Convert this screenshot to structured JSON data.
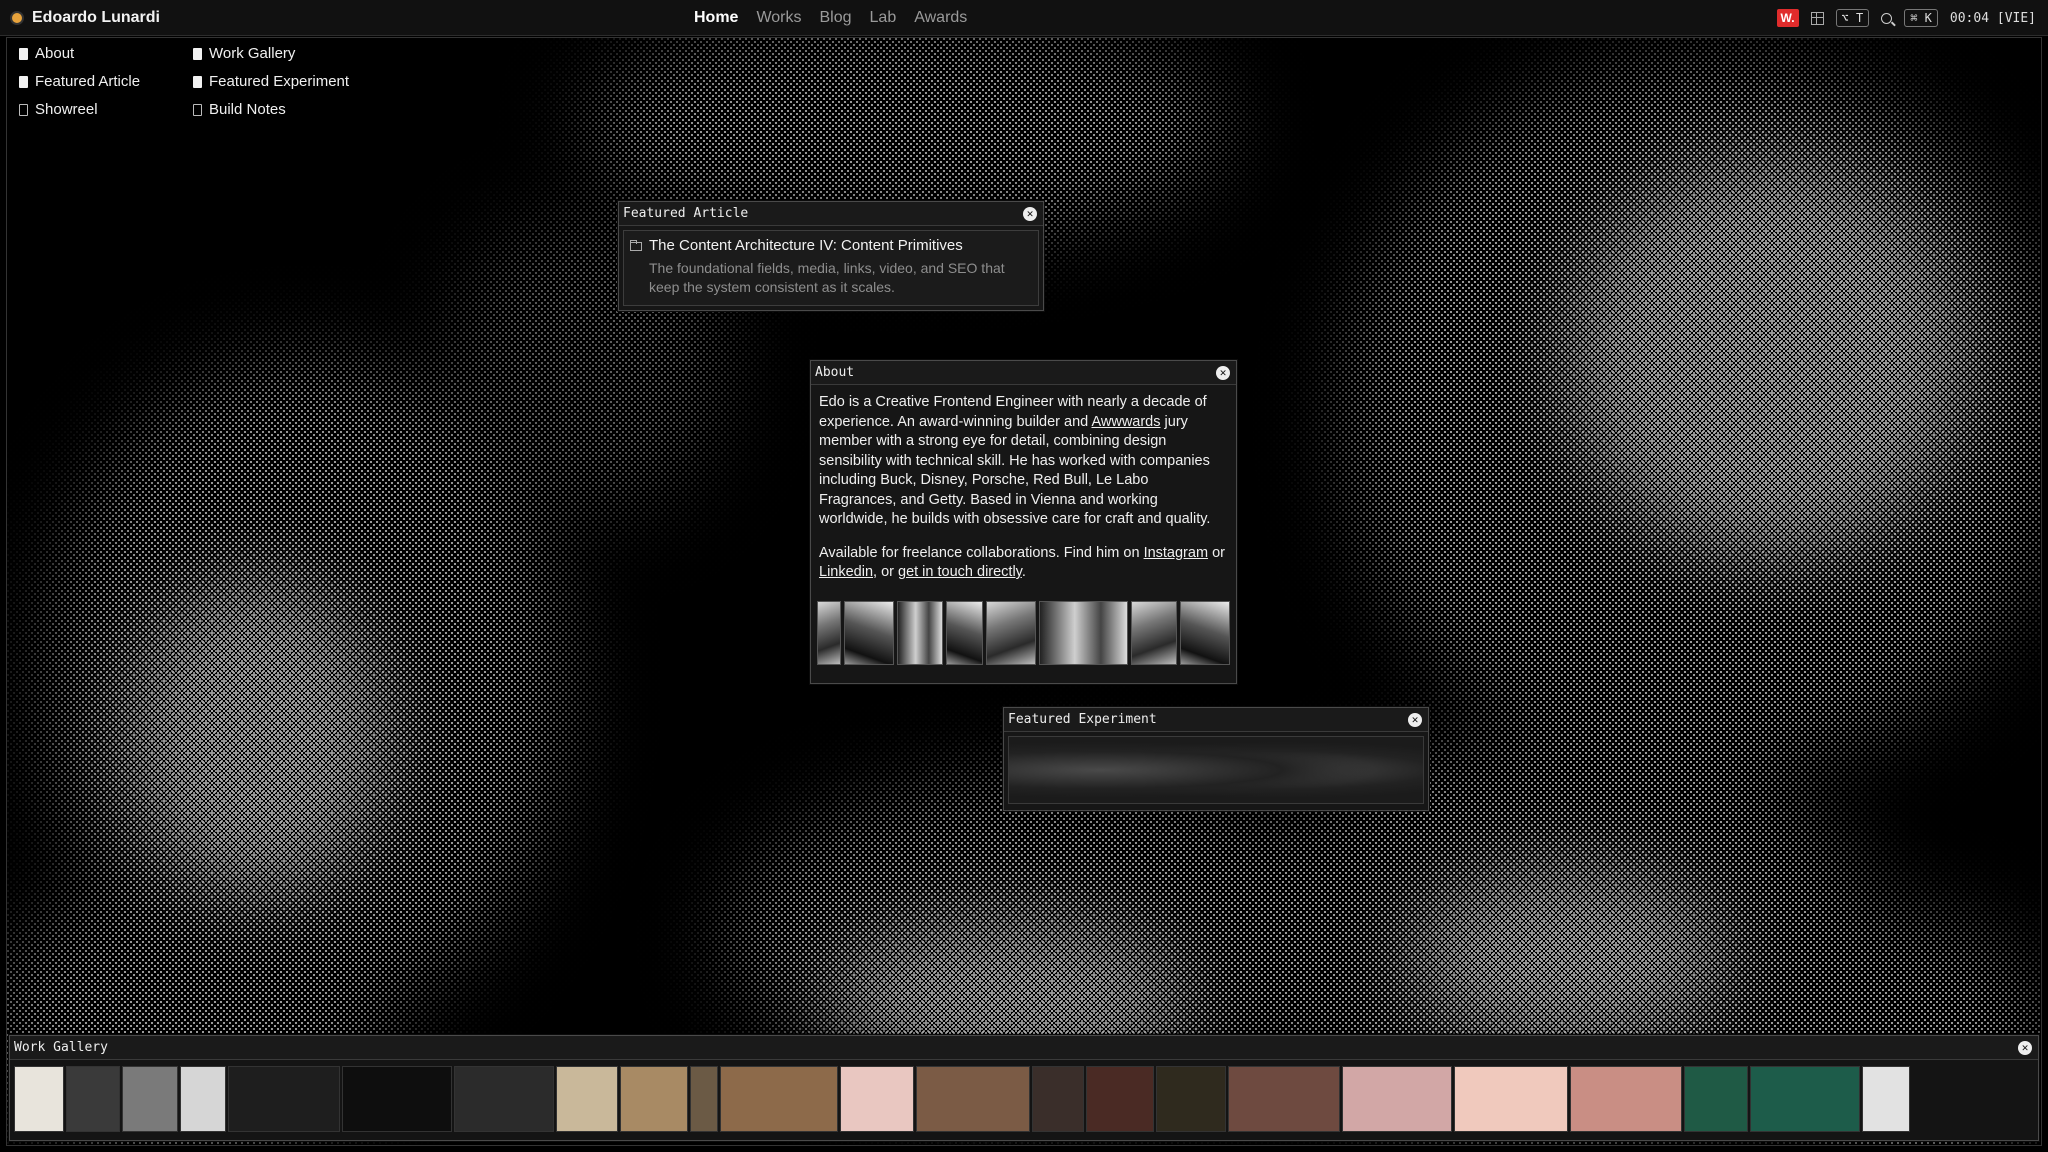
{
  "topbar": {
    "brand": "Edoardo Lunardi",
    "nav": [
      "Home",
      "Works",
      "Blog",
      "Lab",
      "Awards"
    ],
    "nav_active": "Home",
    "w_badge": "W.",
    "shortcut_theme": "⌥ T",
    "shortcut_search": "⌘ K",
    "clock": "00:04 [VIE]"
  },
  "desktop_icons": {
    "about": "About",
    "featured_article": "Featured Article",
    "showreel": "Showreel",
    "work_gallery": "Work Gallery",
    "featured_experiment": "Featured Experiment",
    "build_notes": "Build Notes"
  },
  "article_window": {
    "title": "Featured Article",
    "item_title": "The Content Architecture IV: Content Primitives",
    "item_desc": "The foundational fields, media, links, video, and SEO that keep the system consistent as it scales."
  },
  "about_window": {
    "title": "About",
    "p1_a": "Edo is a Creative Frontend Engineer with nearly a decade of experience. An award-winning builder and ",
    "p1_link": "Awwwards",
    "p1_b": " jury member with a strong eye for detail, combining design sensibility with technical skill. He has worked with companies including Buck, Disney, Porsche, Red Bull, Le Labo Fragrances, and Getty. Based in Vienna and working worldwide, he builds with obsessive care for craft and quality.",
    "p2_a": "Available for freelance collaborations. Find him on ",
    "p2_link1": "Instagram",
    "p2_b": " or ",
    "p2_link2": "Linkedin",
    "p2_c": ", or ",
    "p2_link3": "get in touch directly",
    "p2_d": "."
  },
  "experiment_window": {
    "title": "Featured Experiment"
  },
  "gallery_window": {
    "title": "Work Gallery",
    "thumb_colors": [
      "#e8e4dc",
      "#3a3a3a",
      "#7a7a7a",
      "#d6d6d6",
      "#1e1e1e",
      "#0e0e0e",
      "#2b2b2b",
      "#c9b89a",
      "#a88a64",
      "#6b5a45",
      "#8d6a4a",
      "#e9c7c1",
      "#7b5b45",
      "#3a2e2a",
      "#4a2a24",
      "#2f2a1e",
      "#6e4a40",
      "#d2a7a6",
      "#f0c9bd",
      "#c98e84",
      "#1f5a45",
      "#1d5c4a",
      "#e2e2e2"
    ],
    "thumb_widths": [
      50,
      54,
      56,
      46,
      112,
      110,
      100,
      62,
      68,
      28,
      118,
      74,
      114,
      52,
      68,
      70,
      112,
      110,
      114,
      112,
      64,
      110,
      48
    ]
  },
  "colors": {
    "accent_red": "#e02c2c",
    "background": "#000000",
    "pattern": "#8a8a8a"
  }
}
